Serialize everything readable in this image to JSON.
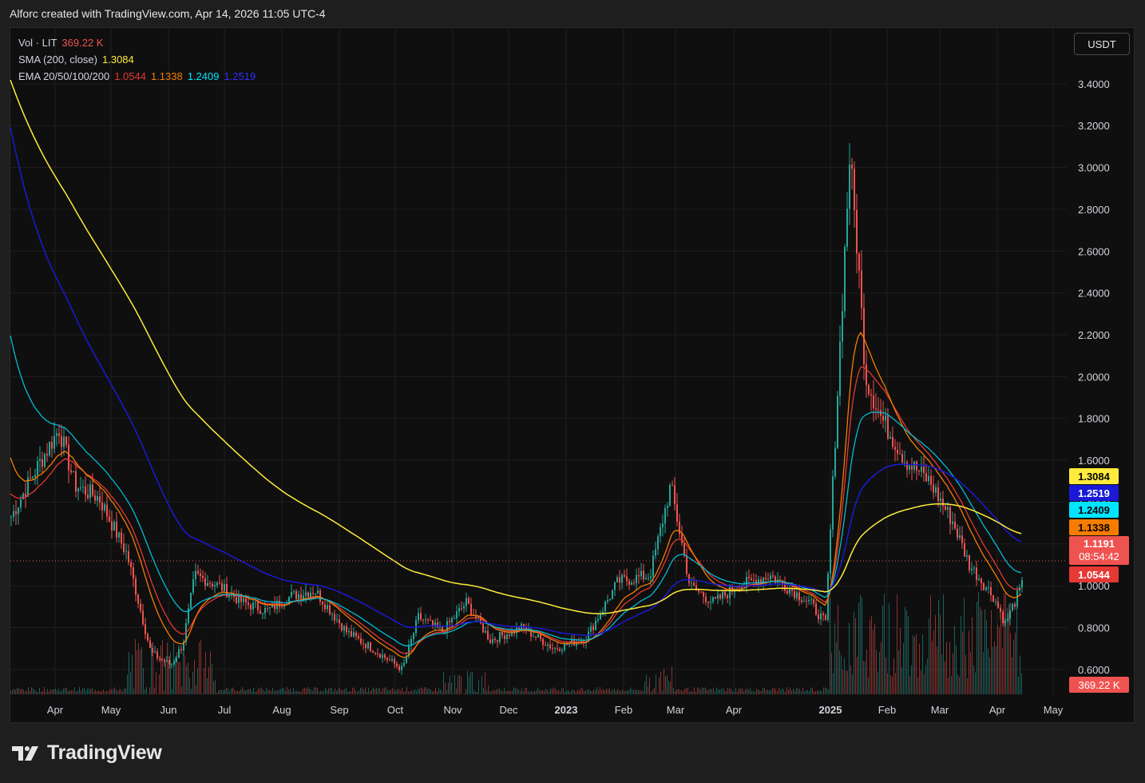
{
  "header": {
    "title": "Alforc created with TradingView.com, Apr 14, 2026 11:05 UTC-4"
  },
  "legend": {
    "vol_label": "Vol · LIT",
    "vol_value": "369.22 K",
    "sma_label": "SMA (200, close)",
    "sma_value": "1.3084",
    "ema_label": "EMA 20/50/100/200",
    "ema20_value": "1.0544",
    "ema50_value": "1.1338",
    "ema100_value": "1.2409",
    "ema200_value": "1.2519"
  },
  "currency_button": "USDT",
  "price_tags": {
    "sma": "1.3084",
    "ema200": "1.2519",
    "ema100": "1.2409",
    "ema50": "1.1338",
    "last_price": "1.1191",
    "countdown": "08:54:42",
    "ema20": "1.0544",
    "volume": "369.22 K"
  },
  "colors": {
    "up": "#26a69a",
    "down": "#ef5350",
    "sma": "#ffeb3b",
    "ema20": "#e53935",
    "ema50": "#f57c00",
    "ema100": "#00bcd4",
    "ema200": "#1a1ad6"
  },
  "brand": {
    "name": "TradingView"
  },
  "chart_data": {
    "type": "candlestick",
    "y_axis": {
      "ticks": [
        "3.4000",
        "3.2000",
        "3.0000",
        "2.8000",
        "2.6000",
        "2.4000",
        "2.2000",
        "2.0000",
        "1.8000",
        "1.6000",
        "1.4000",
        "1.2000",
        "1.0000",
        "0.8000",
        "0.6000"
      ],
      "range": [
        0.4,
        3.5
      ]
    },
    "x_axis": {
      "ticks": [
        "Apr",
        "May",
        "Jun",
        "Jul",
        "Aug",
        "Sep",
        "Oct",
        "Nov",
        "Dec",
        "2023",
        "Feb",
        "Mar",
        "Apr",
        "2025",
        "Feb",
        "Mar",
        "Apr",
        "May"
      ]
    },
    "series": [
      {
        "name": "SMA (200, close)",
        "last": 1.3084
      },
      {
        "name": "EMA 20",
        "last": 1.0544
      },
      {
        "name": "EMA 50",
        "last": 1.1338
      },
      {
        "name": "EMA 100",
        "last": 1.2409
      },
      {
        "name": "EMA 200",
        "last": 1.2519
      }
    ],
    "last_price": 1.1191,
    "volume_last": "369.22 K",
    "approx_close_path": [
      [
        0,
        1.33
      ],
      [
        30,
        1.55
      ],
      [
        60,
        1.75
      ],
      [
        80,
        1.48
      ],
      [
        110,
        1.42
      ],
      [
        145,
        1.15
      ],
      [
        175,
        0.68
      ],
      [
        200,
        0.62
      ],
      [
        215,
        0.72
      ],
      [
        230,
        1.05
      ],
      [
        260,
        1.0
      ],
      [
        290,
        0.92
      ],
      [
        320,
        0.88
      ],
      [
        350,
        0.95
      ],
      [
        380,
        0.98
      ],
      [
        420,
        0.78
      ],
      [
        460,
        0.68
      ],
      [
        490,
        0.6
      ],
      [
        510,
        0.85
      ],
      [
        540,
        0.78
      ],
      [
        570,
        0.92
      ],
      [
        600,
        0.74
      ],
      [
        640,
        0.8
      ],
      [
        680,
        0.7
      ],
      [
        720,
        0.75
      ],
      [
        760,
        1.02
      ],
      [
        800,
        1.05
      ],
      [
        826,
        1.48
      ],
      [
        850,
        1.0
      ],
      [
        880,
        0.92
      ],
      [
        910,
        1.0
      ],
      [
        950,
        1.05
      ],
      [
        1000,
        0.92
      ],
      [
        1020,
        0.82
      ],
      [
        1040,
        2.3
      ],
      [
        1050,
        3.05
      ],
      [
        1060,
        2.6
      ],
      [
        1070,
        2.0
      ],
      [
        1090,
        1.8
      ],
      [
        1120,
        1.6
      ],
      [
        1150,
        1.5
      ],
      [
        1180,
        1.3
      ],
      [
        1200,
        1.1
      ],
      [
        1230,
        0.95
      ],
      [
        1245,
        0.82
      ],
      [
        1260,
        0.95
      ],
      [
        1280,
        1.12
      ]
    ]
  }
}
